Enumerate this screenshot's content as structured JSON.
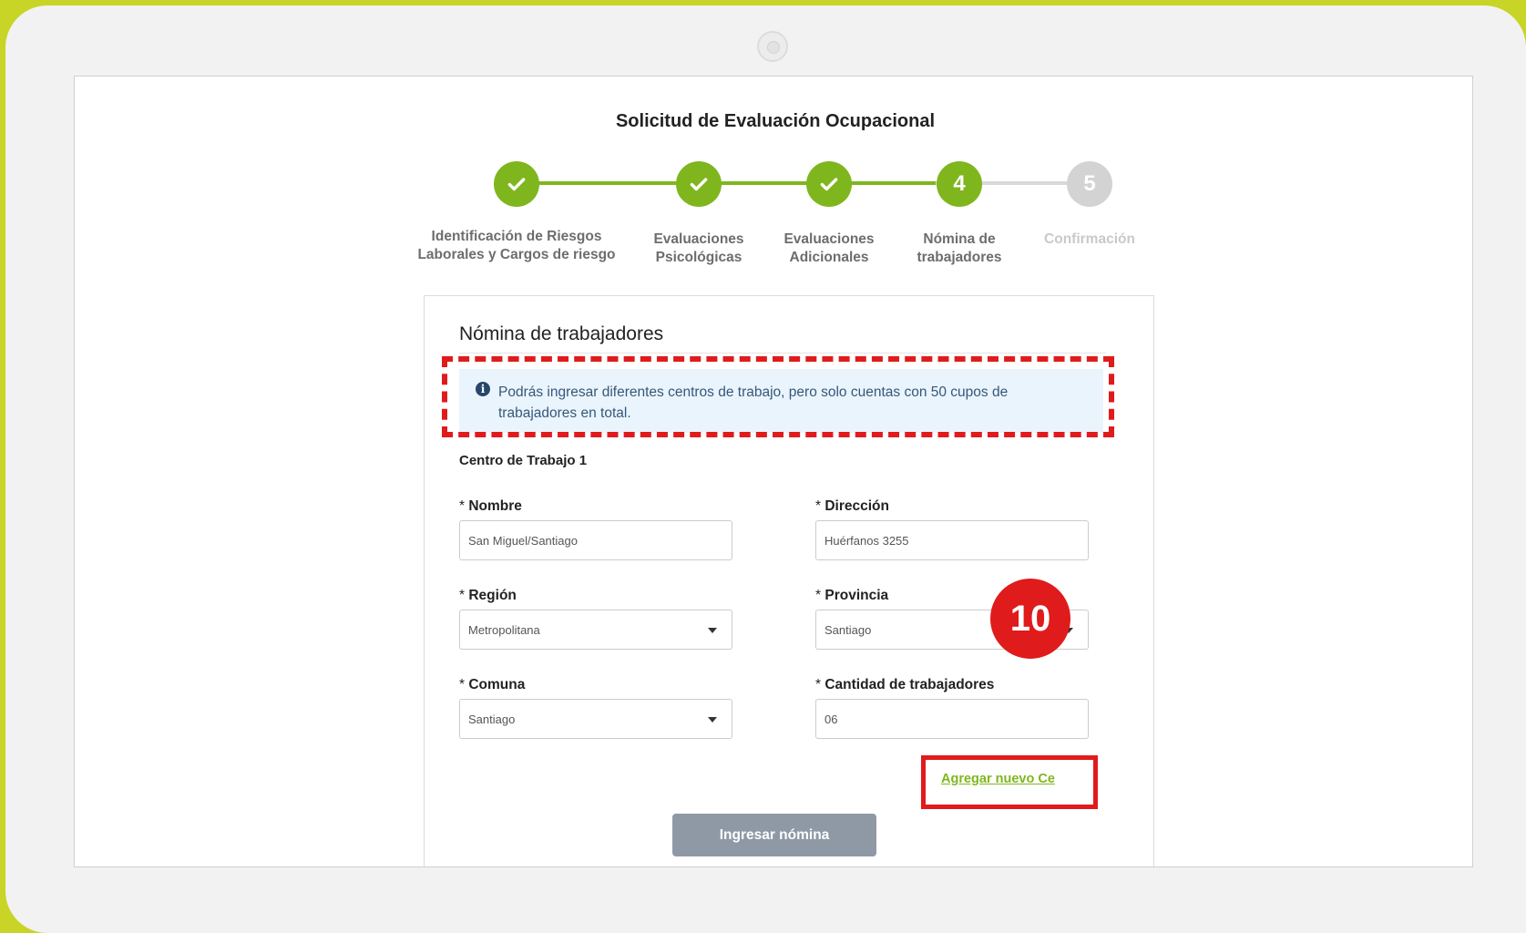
{
  "page": {
    "title": "Solicitud de Evaluación Ocupacional"
  },
  "stepper": {
    "steps": [
      {
        "label_line1": "Identificación de Riesgos",
        "label_line2": "Laborales y Cargos de riesgo",
        "status": "completed",
        "number": "1"
      },
      {
        "label_line1": "Evaluaciones",
        "label_line2": "Psicológicas",
        "status": "completed",
        "number": "2"
      },
      {
        "label_line1": "Evaluaciones",
        "label_line2": "Adicionales",
        "status": "completed",
        "number": "3"
      },
      {
        "label_line1": "Nómina de",
        "label_line2": "trabajadores",
        "status": "current",
        "number": "4"
      },
      {
        "label_line1": "Confirmación",
        "label_line2": "",
        "status": "pending",
        "number": "5"
      }
    ]
  },
  "form": {
    "title": "Nómina de trabajadores",
    "info": "Podrás ingresar diferentes centros de trabajo, pero solo cuentas con 50 cupos de trabajadores en total.",
    "section_title": "Centro de Trabajo 1",
    "required_mark": "*",
    "fields": {
      "nombre": {
        "label": "Nombre",
        "value": "San Miguel/Santiago"
      },
      "direccion": {
        "label": "Dirección",
        "value": "Huérfanos 3255"
      },
      "region": {
        "label": "Región",
        "value": "Metropolitana"
      },
      "provincia": {
        "label": "Provincia",
        "value": "Santiago"
      },
      "comuna": {
        "label": "Comuna",
        "value": "Santiago"
      },
      "cantidad": {
        "label": "Cantidad de trabajadores",
        "value": "06"
      }
    },
    "add_link": "Agregar nuevo Ce",
    "submit_label": "Ingresar nómina"
  },
  "annotation": {
    "badge_number": "10",
    "color": "#e01b1b"
  },
  "colors": {
    "accent_green": "#7fb61e",
    "inactive_grey": "#d3d3d3",
    "frame": "#c8d426"
  }
}
